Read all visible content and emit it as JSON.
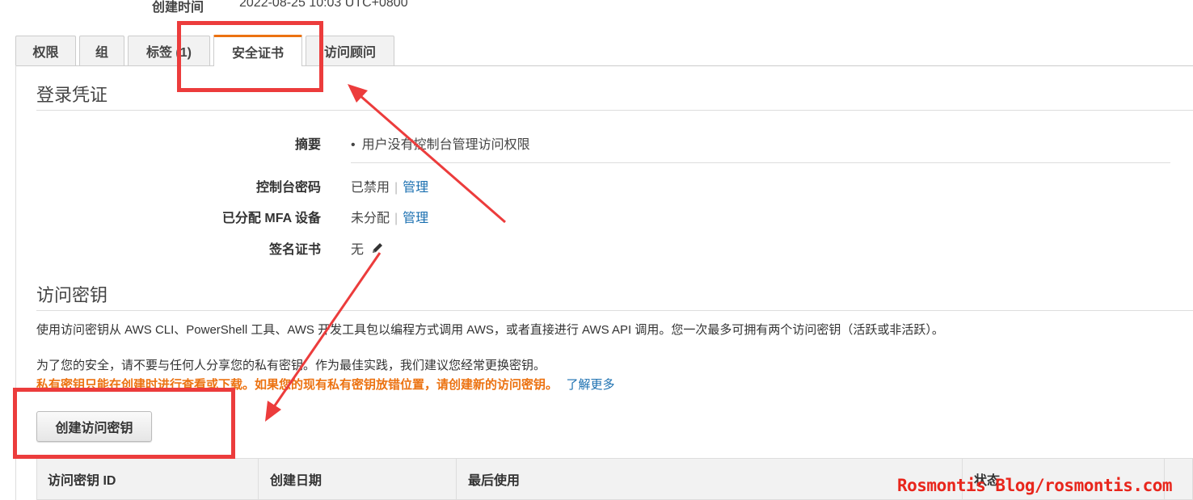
{
  "header": {
    "created_label": "创建时间",
    "created_value": "2022-08-25 10:03 UTC+0800"
  },
  "tabs": [
    {
      "label": "权限",
      "active": false
    },
    {
      "label": "组",
      "active": false
    },
    {
      "label": "标签 (1)",
      "active": false
    },
    {
      "label": "安全证书",
      "active": true
    },
    {
      "label": "访问顾问",
      "active": false
    }
  ],
  "login_credentials": {
    "title": "登录凭证",
    "summary_label": "摘要",
    "summary_value": "用户没有控制台管理访问权限",
    "console_password_label": "控制台密码",
    "console_password_value": "已禁用",
    "console_password_link": "管理",
    "mfa_label": "已分配 MFA 设备",
    "mfa_value": "未分配",
    "mfa_link": "管理",
    "signing_cert_label": "签名证书",
    "signing_cert_value": "无"
  },
  "access_keys": {
    "title": "访问密钥",
    "description": "使用访问密钥从 AWS CLI、PowerShell 工具、AWS 开发工具包以编程方式调用 AWS，或者直接进行 AWS API 调用。您一次最多可拥有两个访问密钥（活跃或非活跃）。",
    "security_note": "为了您的安全，请不要与任何人分享您的私有密钥。作为最佳实践，我们建议您经常更换密钥。",
    "warning": "私有密钥只能在创建时进行查看或下载。如果您的现有私有密钥放错位置，请创建新的访问密钥。",
    "learn_more": "了解更多",
    "create_button": "创建访问密钥",
    "table_headers": [
      "访问密钥 ID",
      "创建日期",
      "最后使用",
      "状态"
    ]
  },
  "watermark": "Rosmontis Blog/rosmontis.com",
  "colors": {
    "accent_orange": "#ec7211",
    "link_blue": "#1a6fb0",
    "annotation_red": "#ec3c3c"
  }
}
